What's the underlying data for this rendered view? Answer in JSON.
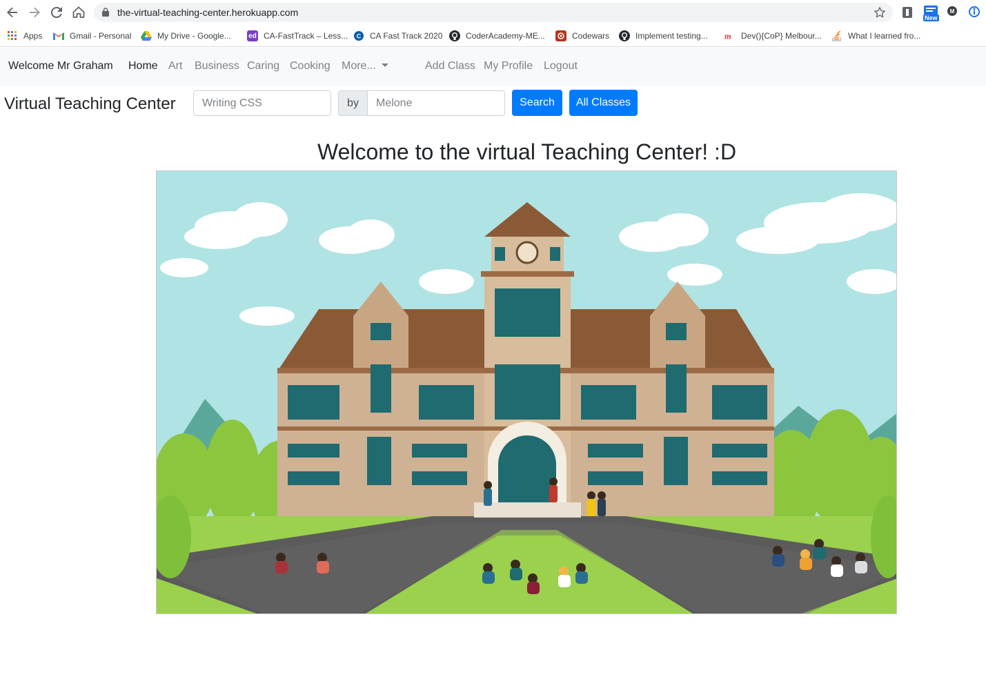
{
  "browser": {
    "url": "the-virtual-teaching-center.herokuapp.com",
    "new_badge": "New",
    "bookmarks": [
      {
        "label": "Apps",
        "icon": "apps-grid-icon",
        "color": "#4285f4"
      },
      {
        "label": "Gmail - Personal",
        "icon": "gmail-icon",
        "color": "#ea4335"
      },
      {
        "label": "My Drive - Google...",
        "icon": "google-drive-icon",
        "color": "#34a853"
      },
      {
        "label": "CA-FastTrack – Less...",
        "icon": "ed-icon",
        "color": "#7b3fc4"
      },
      {
        "label": "CA Fast Track 2020",
        "icon": "coder-academy-icon",
        "color": "#0b5ea8"
      },
      {
        "label": "CoderAcademy-ME...",
        "icon": "github-icon",
        "color": "#24292e"
      },
      {
        "label": "Codewars",
        "icon": "codewars-icon",
        "color": "#b1361e"
      },
      {
        "label": "Implement testing...",
        "icon": "github-icon",
        "color": "#24292e"
      },
      {
        "label": "Dev(){CoP} Melbour...",
        "icon": "meetup-icon",
        "color": "#e0393e"
      },
      {
        "label": "What I learned fro...",
        "icon": "stackoverflow-icon",
        "color": "#f48024"
      }
    ]
  },
  "navbar": {
    "welcome": "Welcome Mr Graham",
    "links": [
      {
        "label": "Home",
        "active": true
      },
      {
        "label": "Art"
      },
      {
        "label": "Business"
      },
      {
        "label": "Caring"
      },
      {
        "label": "Cooking"
      },
      {
        "label": "More..."
      },
      {
        "label": "Add Class"
      },
      {
        "label": "My Profile"
      },
      {
        "label": "Logout"
      }
    ]
  },
  "search": {
    "site_title": "Virtual Teaching Center",
    "class_placeholder": "Writing CSS",
    "by_label": "by",
    "teacher_placeholder": "Melone",
    "search_button": "Search",
    "all_classes_button": "All Classes"
  },
  "hero": {
    "title": "Welcome to the virtual Teaching Center! :D"
  },
  "colors": {
    "primary": "#007bff",
    "navbar_bg": "#f8f9fa"
  }
}
